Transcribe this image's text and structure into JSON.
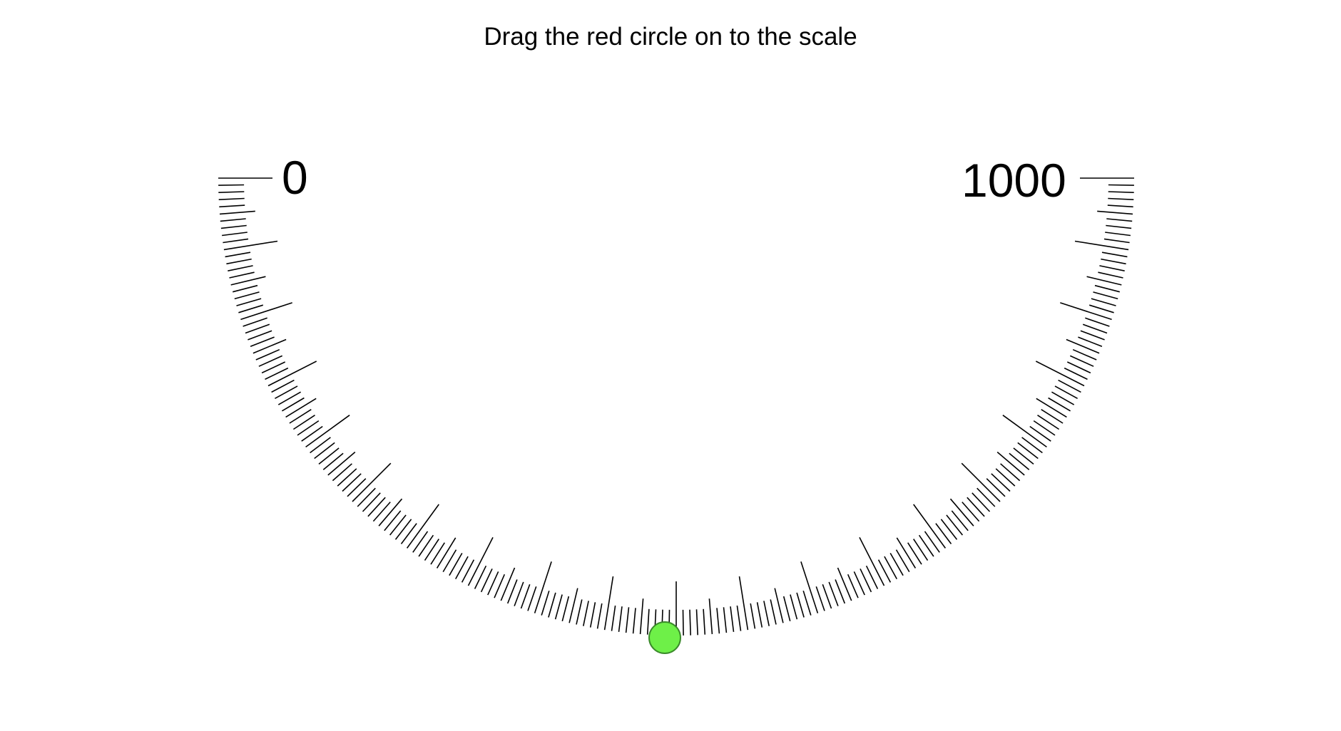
{
  "instruction": "Drag the red circle on to the scale",
  "scale": {
    "min_label": "0",
    "max_label": "1000",
    "min": 0,
    "max": 1000,
    "shape": "semicircle",
    "minor_tick_interval": 5,
    "medium_tick_interval": 25,
    "major_tick_interval": 50
  },
  "marker": {
    "shape": "circle",
    "fill_color": "#6ef048",
    "border_color": "#3a8a2a",
    "value": 490
  },
  "colors": {
    "background": "#ffffff",
    "tick": "#000000",
    "text": "#000000"
  }
}
